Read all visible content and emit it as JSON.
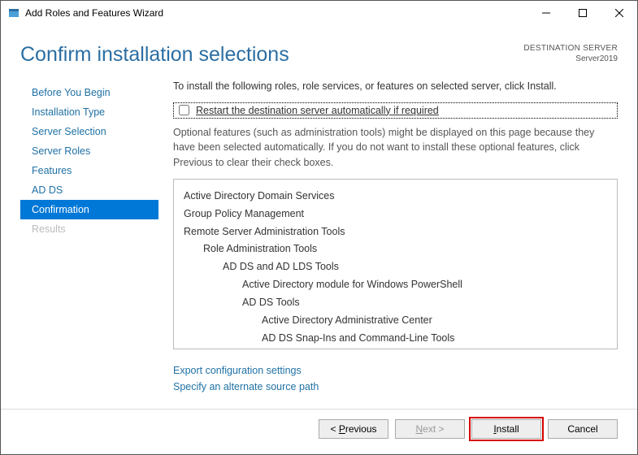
{
  "window": {
    "title": "Add Roles and Features Wizard"
  },
  "header": {
    "title": "Confirm installation selections",
    "destination_label": "DESTINATION SERVER",
    "destination_server": "Server2019"
  },
  "sidebar": {
    "items": [
      {
        "label": "Before You Begin",
        "state": "normal"
      },
      {
        "label": "Installation Type",
        "state": "normal"
      },
      {
        "label": "Server Selection",
        "state": "normal"
      },
      {
        "label": "Server Roles",
        "state": "normal"
      },
      {
        "label": "Features",
        "state": "normal"
      },
      {
        "label": "AD DS",
        "state": "normal"
      },
      {
        "label": "Confirmation",
        "state": "active"
      },
      {
        "label": "Results",
        "state": "disabled"
      }
    ]
  },
  "main": {
    "intro": "To install the following roles, role services, or features on selected server, click Install.",
    "restart_checkbox_label": "Restart the destination server automatically if required",
    "restart_checked": false,
    "optional_note": "Optional features (such as administration tools) might be displayed on this page because they have been selected automatically. If you do not want to install these optional features, click Previous to clear their check boxes.",
    "selections": [
      {
        "label": "Active Directory Domain Services",
        "indent": 0
      },
      {
        "label": "Group Policy Management",
        "indent": 0
      },
      {
        "label": "Remote Server Administration Tools",
        "indent": 0
      },
      {
        "label": "Role Administration Tools",
        "indent": 1
      },
      {
        "label": "AD DS and AD LDS Tools",
        "indent": 2
      },
      {
        "label": "Active Directory module for Windows PowerShell",
        "indent": 3
      },
      {
        "label": "AD DS Tools",
        "indent": 3
      },
      {
        "label": "Active Directory Administrative Center",
        "indent": 4
      },
      {
        "label": "AD DS Snap-Ins and Command-Line Tools",
        "indent": 4
      }
    ],
    "links": {
      "export": "Export configuration settings",
      "alt_source": "Specify an alternate source path"
    }
  },
  "footer": {
    "previous_prefix": "< ",
    "previous_accel": "P",
    "previous_rest": "revious",
    "next_accel": "N",
    "next_rest": "ext >",
    "install_accel": "I",
    "install_rest": "nstall",
    "cancel": "Cancel",
    "next_enabled": false
  }
}
